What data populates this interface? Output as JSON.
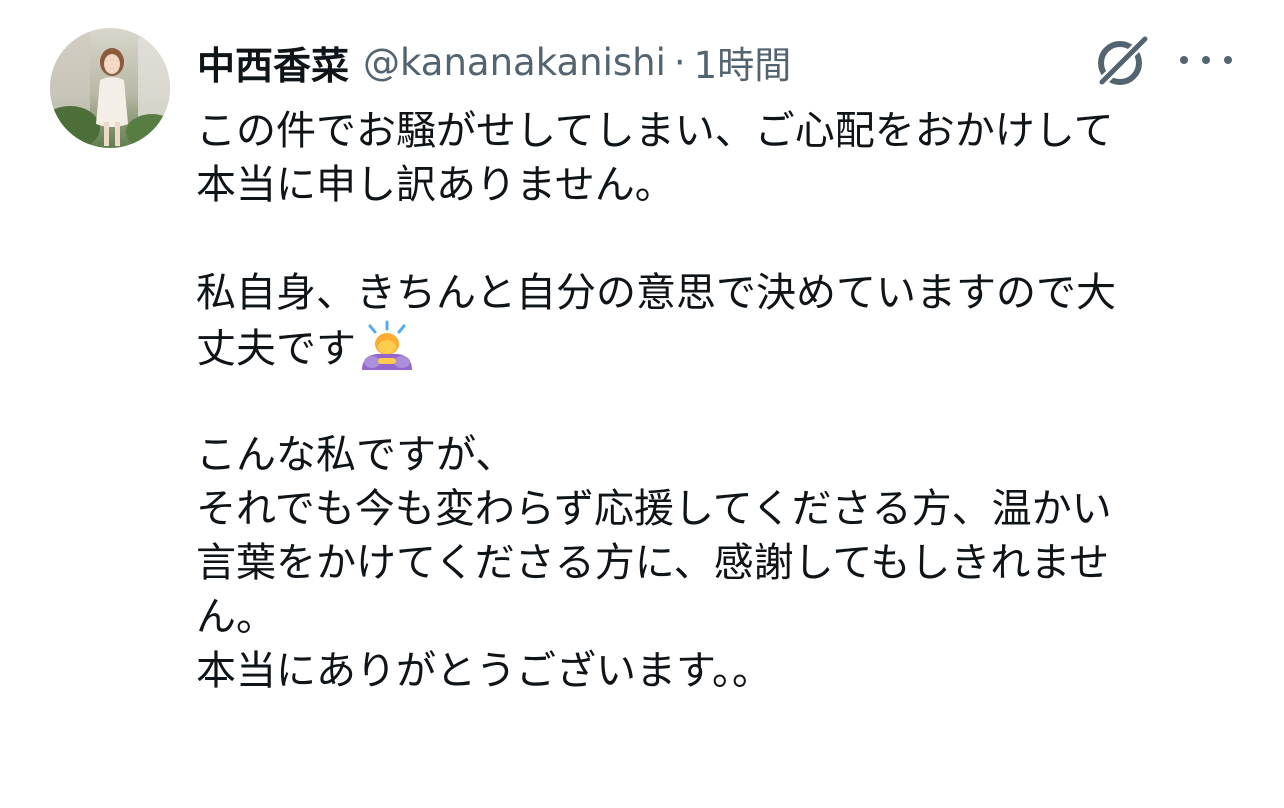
{
  "tweet": {
    "display_name": "中西香菜",
    "handle": "@kananakanishi",
    "separator": "·",
    "time": "1時間",
    "grok_icon": "grok-slash-circle-icon",
    "more_icon": "more-horizontal-icon",
    "body": {
      "p1": {
        "l1": "この件でお騒がせしてしまい、ご心配をおかけして",
        "l2": "本当に申し訳ありません。"
      },
      "p2": {
        "l1": "私自身、きちんと自分の意思で決めていますので大",
        "l2": "丈夫です",
        "emoji": "person-bowing-emoji"
      },
      "p3": {
        "l1": "こんな私ですが、",
        "l2": "それでも今も変わらず応援してくださる方、温かい",
        "l3": "言葉をかけてくださる方に、感謝してもしきれませ",
        "l4": "ん。",
        "l5": "本当にありがとうございます。。"
      }
    }
  },
  "colors": {
    "text_primary": "#0f1419",
    "text_secondary": "#536471",
    "background": "#ffffff"
  }
}
